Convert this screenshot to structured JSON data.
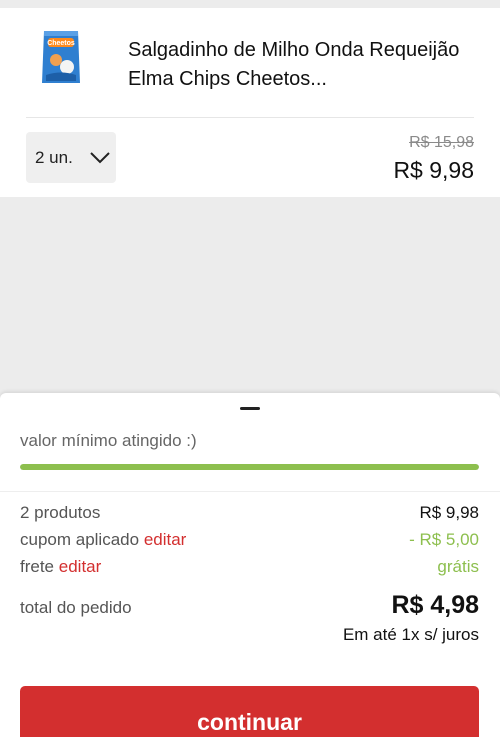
{
  "product": {
    "name": "Salgadinho de Milho Onda Requeijão Elma Chips Cheetos...",
    "quantity": "2 un.",
    "price_original": "R$ 15,98",
    "price_current": "R$ 9,98",
    "thumbnail_icon": "cheetos-bag-icon",
    "thumbnail_logo_text": "Cheetos"
  },
  "summary": {
    "min_value_text": "valor mínimo atingido :)",
    "progress": 1.0,
    "products_label": "2 produtos",
    "products_value": "R$ 9,98",
    "coupon_label": "cupom aplicado",
    "coupon_edit": "editar",
    "coupon_value": "- R$ 5,00",
    "shipping_label": "frete",
    "shipping_edit": "editar",
    "shipping_value": "grátis",
    "total_label": "total do pedido",
    "total_value": "R$ 4,98",
    "installments": "Em até 1x s/ juros"
  },
  "actions": {
    "continue_label": "continuar"
  },
  "colors": {
    "accent_red": "#d32f2f",
    "success_green": "#8dbf4e",
    "background": "#ececec"
  }
}
